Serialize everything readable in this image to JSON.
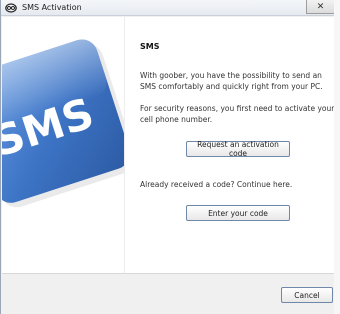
{
  "window": {
    "title": "SMS Activation",
    "close_glyph": "✕"
  },
  "graphic": {
    "text": "SMS",
    "icon": "sms-badge-graphic",
    "color": "#3d74c5"
  },
  "main": {
    "heading": "SMS",
    "intro": "With goober, you have the possibility to send an SMS comfortably and quickly right from your PC.",
    "security_note": "For security reasons, you first need to activate your cell phone number.",
    "request_button": "Request an activation code",
    "already_received": "Already received a code? Continue here.",
    "enter_button": "Enter your code"
  },
  "footer": {
    "cancel_button": "Cancel"
  }
}
